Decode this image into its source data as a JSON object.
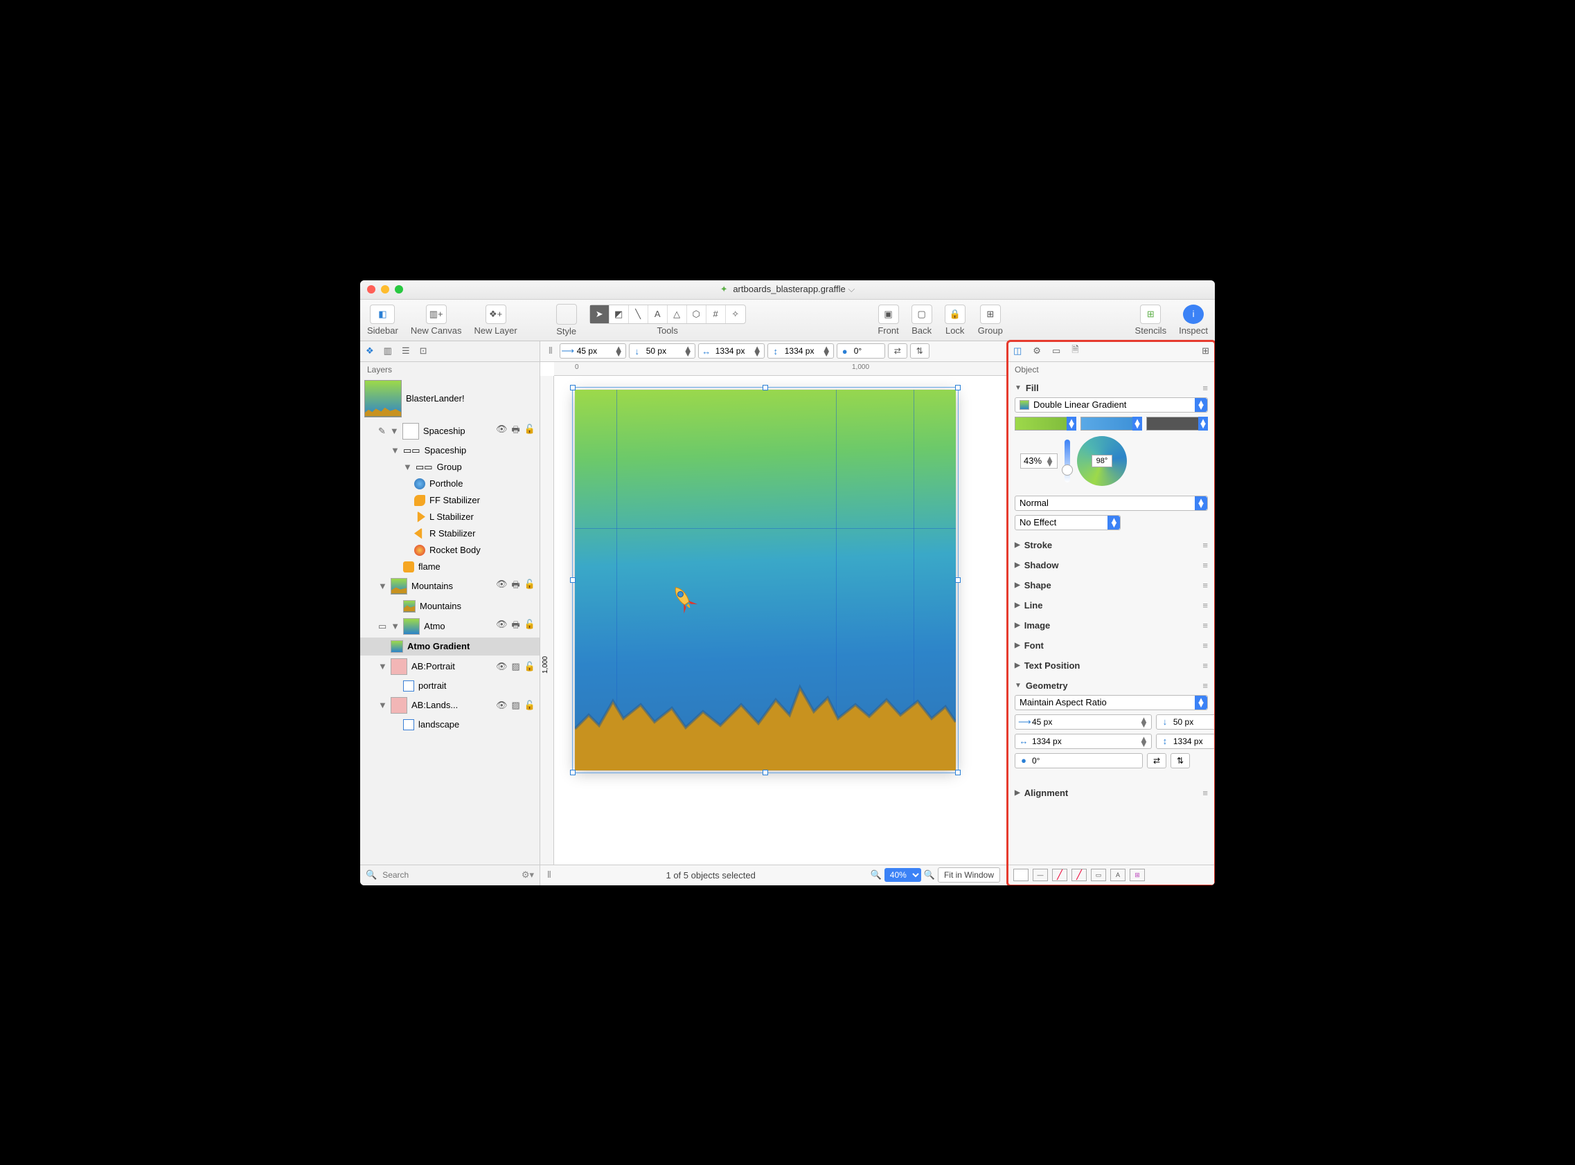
{
  "window": {
    "title": "artboards_blasterapp.graffle"
  },
  "toolbar": {
    "sidebar": "Sidebar",
    "newCanvas": "New Canvas",
    "newLayer": "New Layer",
    "style": "Style",
    "tools": "Tools",
    "front": "Front",
    "back": "Back",
    "lock": "Lock",
    "group": "Group",
    "stencils": "Stencils",
    "inspect": "Inspect"
  },
  "propbar": {
    "x": "45 px",
    "y": "50 px",
    "w": "1334 px",
    "h": "1334 px",
    "rot": "0°"
  },
  "sidebar": {
    "title": "Layers",
    "canvas": "BlasterLander!",
    "layers": {
      "spaceship": "Spaceship",
      "spaceshipObj": "Spaceship",
      "group": "Group",
      "porthole": "Porthole",
      "ff": "FF Stabilizer",
      "lstab": "L Stabilizer",
      "rstab": "R Stabilizer",
      "body": "Rocket Body",
      "flame": "flame",
      "mountainsLayer": "Mountains",
      "mountainsObj": "Mountains",
      "atmo": "Atmo",
      "atmoGrad": "Atmo Gradient",
      "abp": "AB:Portrait",
      "portrait": "portrait",
      "abl": "AB:Lands...",
      "landscape": "landscape"
    },
    "searchPlaceholder": "Search"
  },
  "ruler": {
    "t0": "0",
    "t1000": "1,000",
    "v1000": "1,000"
  },
  "status": {
    "sel": "1 of 5 objects selected",
    "zoom": "40%",
    "fit": "Fit in Window"
  },
  "inspector": {
    "title": "Object",
    "sections": {
      "fill": "Fill",
      "stroke": "Stroke",
      "shadow": "Shadow",
      "shape": "Shape",
      "line": "Line",
      "image": "Image",
      "font": "Font",
      "textpos": "Text Position",
      "geometry": "Geometry",
      "alignment": "Alignment"
    },
    "fill": {
      "type": "Double Linear Gradient",
      "midpoint": "43%",
      "angle": "98°",
      "blend": "Normal",
      "effect": "No Effect",
      "color1": "#9dd94a",
      "color2": "#3b8fd6",
      "color3": "#555555"
    },
    "geometry": {
      "aspect": "Maintain Aspect Ratio",
      "x": "45 px",
      "y": "50 px",
      "w": "1334 px",
      "h": "1334 px",
      "rot": "0°"
    }
  }
}
